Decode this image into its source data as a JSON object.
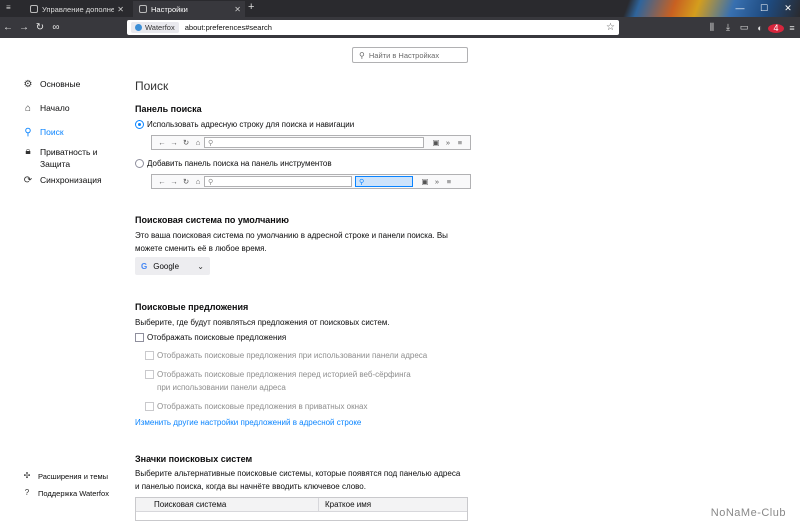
{
  "browser": {
    "tabs": [
      {
        "title": "Управление дополнениями",
        "active": false
      },
      {
        "title": "Настройки",
        "active": true
      }
    ],
    "url_identity": "Waterfox",
    "url": "about:preferences#search",
    "notification_count": "4"
  },
  "prefs_search_placeholder": "Найти в Настройках",
  "sidebar": {
    "items": [
      {
        "label": "Основные",
        "icon": "gear-icon"
      },
      {
        "label": "Начало",
        "icon": "home-icon"
      },
      {
        "label": "Поиск",
        "icon": "search-icon",
        "selected": true
      },
      {
        "label": "Приватность и Защита",
        "icon": "lock-icon"
      },
      {
        "label": "Синхронизация",
        "icon": "sync-icon"
      }
    ],
    "bottom": [
      {
        "label": "Расширения и темы",
        "icon": "puzzle-icon"
      },
      {
        "label": "Поддержка Waterfox",
        "icon": "help-icon"
      }
    ]
  },
  "main": {
    "title": "Поиск",
    "search_bar": {
      "heading": "Панель поиска",
      "option_address": "Использовать адресную строку для поиска и навигации",
      "option_toolbar": "Добавить панель поиска на панель инструментов"
    },
    "default_engine": {
      "heading": "Поисковая система по умолчанию",
      "description": "Это ваша поисковая система по умолчанию в адресной строке и панели поиска. Вы можете сменить её в любое время.",
      "engine": "Google"
    },
    "suggestions": {
      "heading": "Поисковые предложения",
      "description": "Выберите, где будут появляться предложения от поисковых систем.",
      "show": "Отображать поисковые предложения",
      "in_address": "Отображать поисковые предложения при использовании панели адреса",
      "before_history": "Отображать поисковые предложения перед историей веб-сёрфинга при использовании панели адреса",
      "in_private": "Отображать поисковые предложения в приватных окнах",
      "link": "Изменить другие настройки предложений в адресной строке"
    },
    "shortcuts": {
      "heading": "Значки поисковых систем",
      "description": "Выберите альтернативные поисковые системы, которые появятся под панелью адреса и панелью поиска, когда вы начнёте вводить ключевое слово.",
      "col_engine": "Поисковая система",
      "col_keyword": "Краткое имя"
    }
  },
  "watermark": "NoNaMe-Club"
}
